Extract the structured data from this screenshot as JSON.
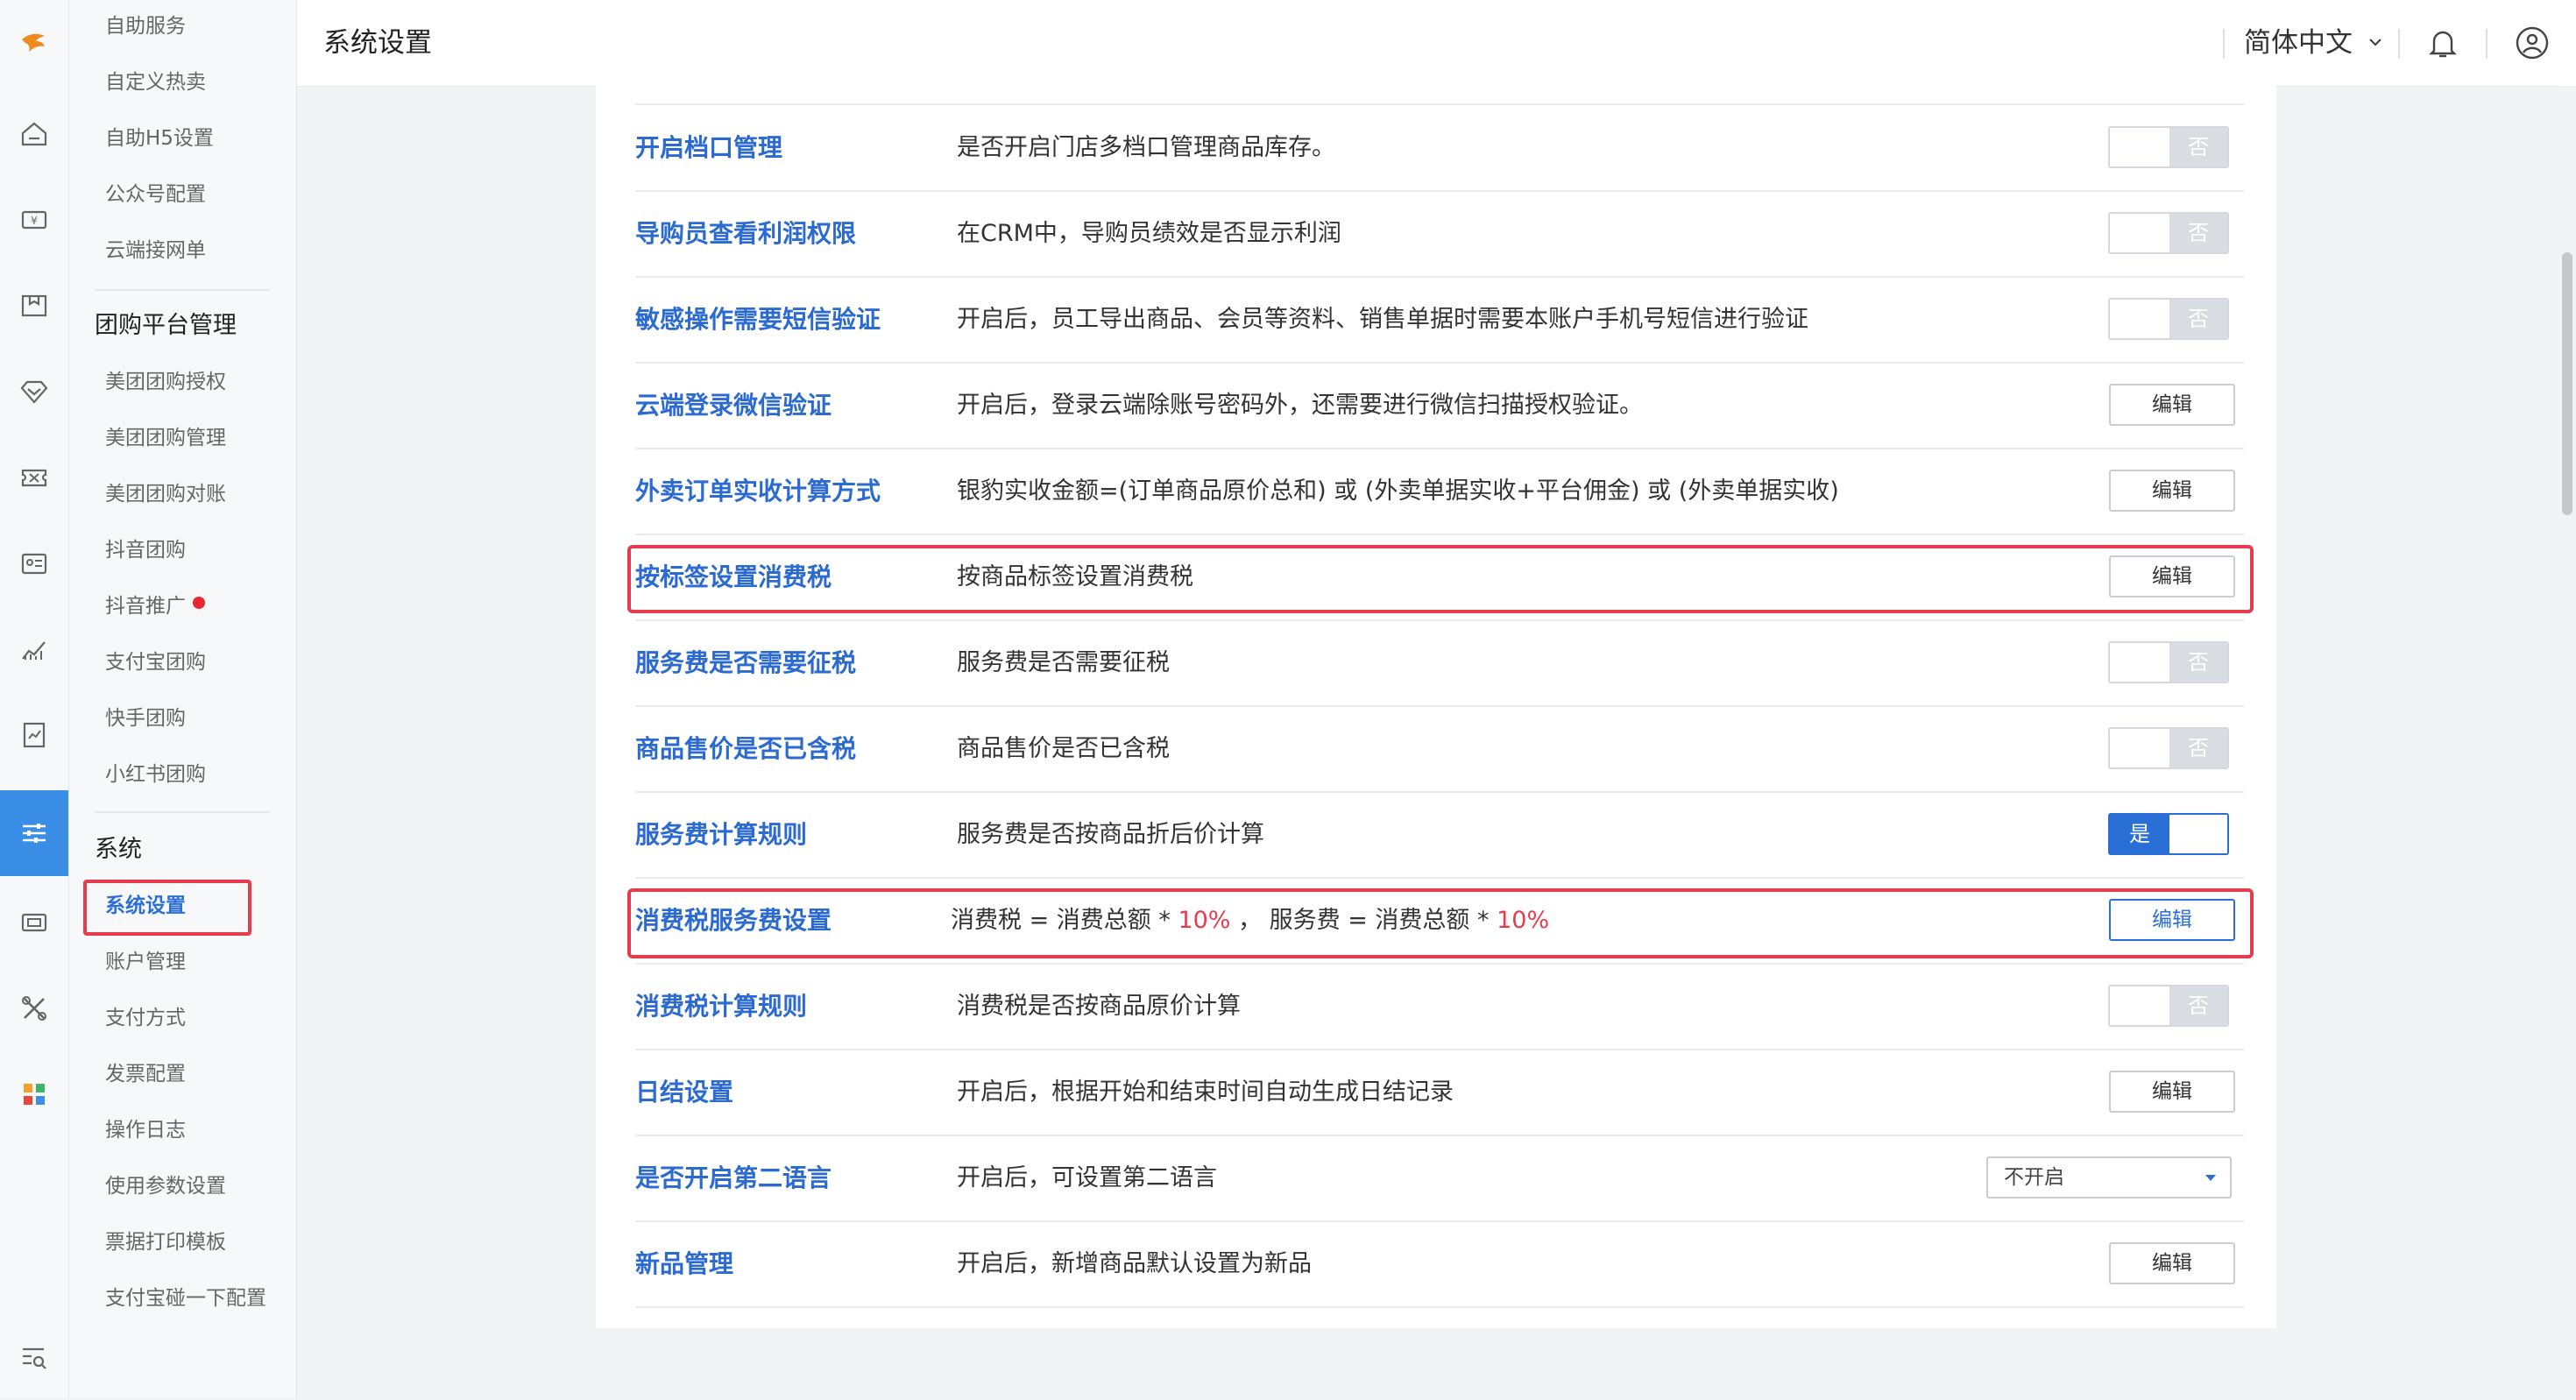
{
  "header": {
    "title": "系统设置",
    "language": "简体中文"
  },
  "submenu": {
    "items_top": [
      "自助服务",
      "自定义热卖",
      "自助H5设置",
      "公众号配置",
      "云端接网单"
    ],
    "group_tuangou": "团购平台管理",
    "items_tuangou": [
      "美团团购授权",
      "美团团购管理",
      "美团团购对账",
      "抖音团购",
      "抖音推广",
      "支付宝团购",
      "快手团购",
      "小红书团购"
    ],
    "group_system": "系统",
    "items_system": [
      "系统设置",
      "账户管理",
      "支付方式",
      "发票配置",
      "操作日志",
      "使用参数设置",
      "票据打印模板",
      "支付宝碰一下配置"
    ]
  },
  "rows": [
    {
      "label": "开启档口管理",
      "desc": "是否开启门店多档口管理商品库存。",
      "control": "toggle",
      "value": "否"
    },
    {
      "label": "导购员查看利润权限",
      "desc": "在CRM中，导购员绩效是否显示利润",
      "control": "toggle",
      "value": "否"
    },
    {
      "label": "敏感操作需要短信验证",
      "desc": "开启后，员工导出商品、会员等资料、销售单据时需要本账户手机号短信进行验证",
      "control": "toggle",
      "value": "否"
    },
    {
      "label": "云端登录微信验证",
      "desc": "开启后，登录云端除账号密码外，还需要进行微信扫描授权验证。",
      "control": "button",
      "value": "编辑"
    },
    {
      "label": "外卖订单实收计算方式",
      "desc": "银豹实收金额=(订单商品原价总和) 或 (外卖单据实收+平台佣金) 或 (外卖单据实收)",
      "control": "button",
      "value": "编辑"
    },
    {
      "label": "按标签设置消费税",
      "desc": "按商品标签设置消费税",
      "control": "button",
      "value": "编辑"
    },
    {
      "label": "服务费是否需要征税",
      "desc": "服务费是否需要征税",
      "control": "toggle",
      "value": "否"
    },
    {
      "label": "商品售价是否已含税",
      "desc": "商品售价是否已含税",
      "control": "toggle",
      "value": "否"
    },
    {
      "label": "服务费计算规则",
      "desc": "服务费是否按商品折后价计算",
      "control": "toggle-on",
      "value": "是"
    },
    {
      "label": "消费税服务费设置",
      "desc_a": "消费税 = 消费总额 * ",
      "desc_b": "10%",
      "desc_c": " ，  服务费 = 消费总额 * ",
      "desc_d": "10%",
      "control": "button-primary",
      "value": "编辑"
    },
    {
      "label": "消费税计算规则",
      "desc": "消费税是否按商品原价计算",
      "control": "toggle",
      "value": "否"
    },
    {
      "label": "日结设置",
      "desc": "开启后，根据开始和结束时间自动生成日结记录",
      "control": "button",
      "value": "编辑"
    },
    {
      "label": "是否开启第二语言",
      "desc": "开启后，可设置第二语言",
      "control": "select",
      "value": "不开启"
    },
    {
      "label": "新品管理",
      "desc": "开启后，新增商品默认设置为新品",
      "control": "button",
      "value": "编辑"
    }
  ],
  "colors": {
    "accent": "#2a6fd6",
    "highlight": "#e63c4f",
    "rail_active": "#3a8ee6"
  }
}
